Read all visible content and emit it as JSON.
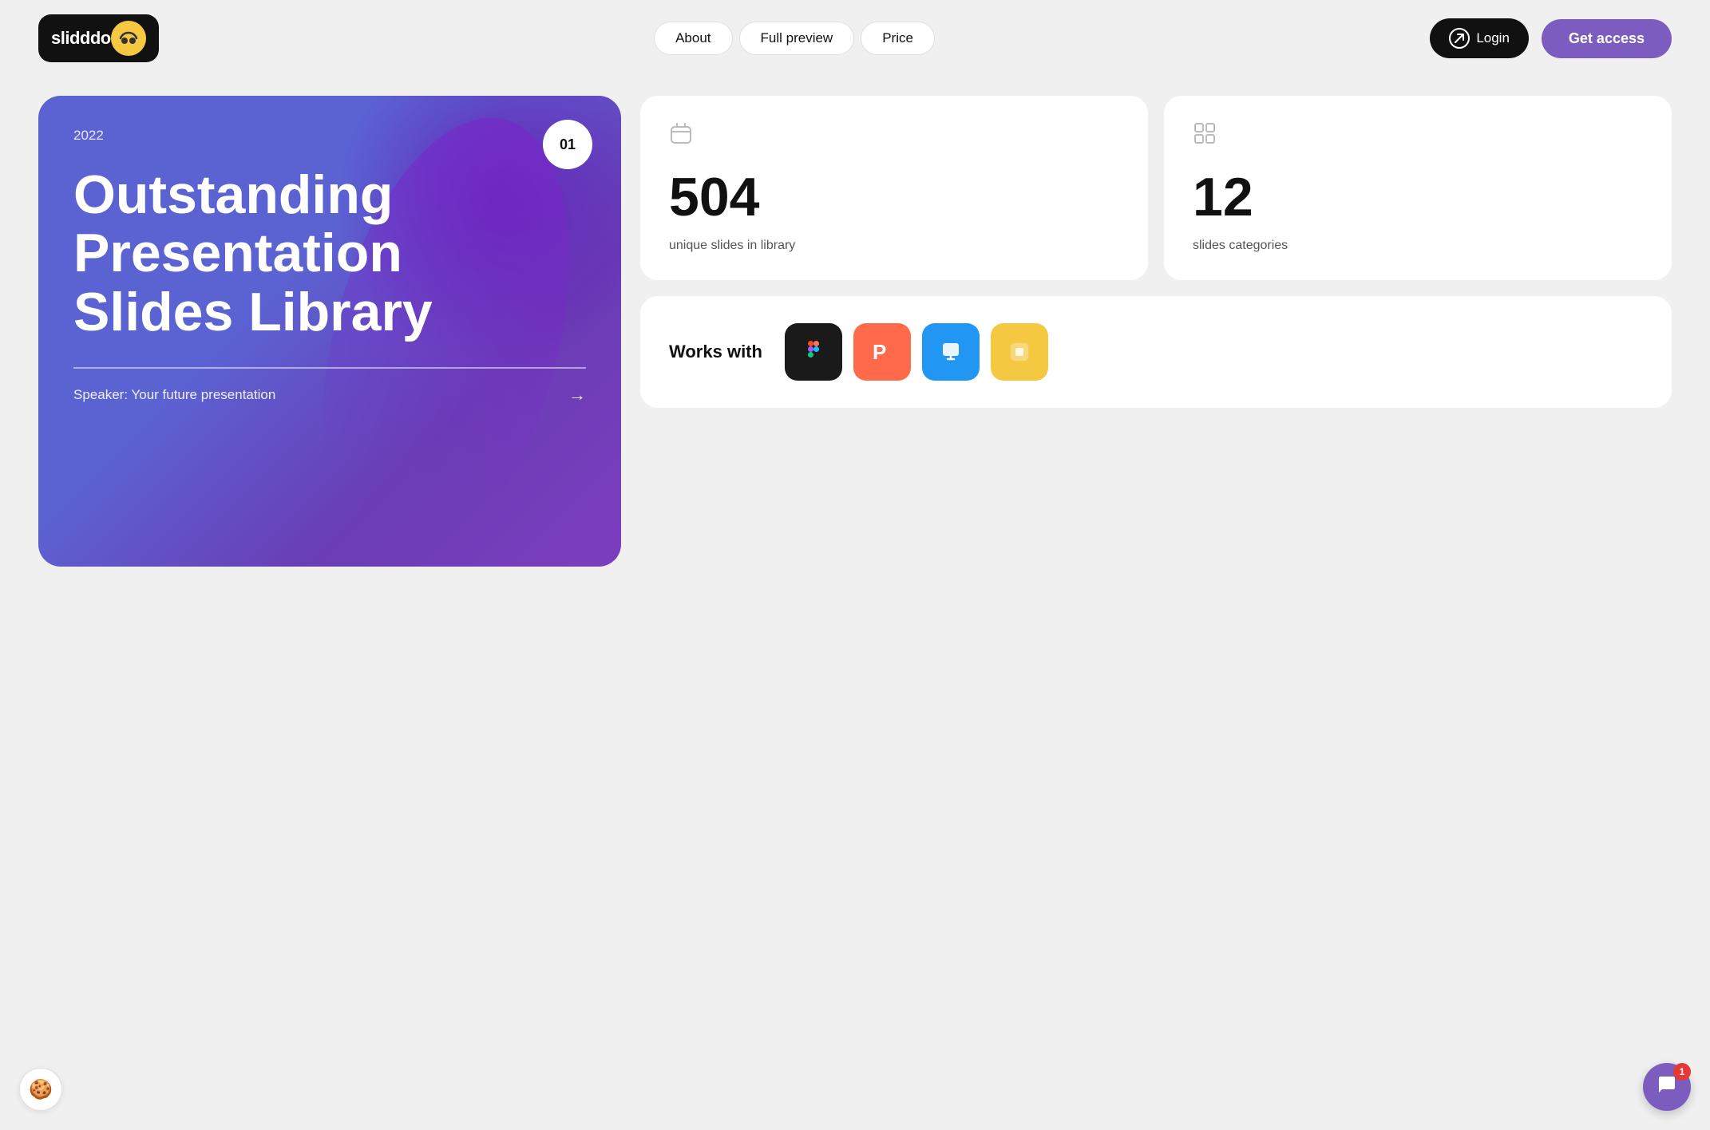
{
  "nav": {
    "logo_text": "slidddo",
    "logo_emoji": "🌀",
    "about_label": "About",
    "full_preview_label": "Full preview",
    "price_label": "Price",
    "login_label": "Login",
    "get_access_label": "Get access"
  },
  "hero": {
    "year": "2022",
    "badge": "01",
    "title": "Outstanding Presentation Slides Library",
    "speaker": "Speaker: Your future presentation",
    "arrow": "→"
  },
  "stats": {
    "unique_slides_number": "504",
    "unique_slides_label": "unique slides in library",
    "categories_number": "12",
    "categories_label": "slides categories"
  },
  "works_with": {
    "label": "Works with",
    "apps": [
      {
        "name": "Figma",
        "emoji": "🎨",
        "bg": "figma"
      },
      {
        "name": "PowerPoint",
        "emoji": "📊",
        "bg": "ppt"
      },
      {
        "name": "Keynote",
        "emoji": "🖥",
        "bg": "keynote"
      },
      {
        "name": "Google Slides",
        "emoji": "🟨",
        "bg": "google"
      }
    ]
  },
  "cookie": {
    "icon": "🍪"
  },
  "chat": {
    "badge": "1"
  }
}
